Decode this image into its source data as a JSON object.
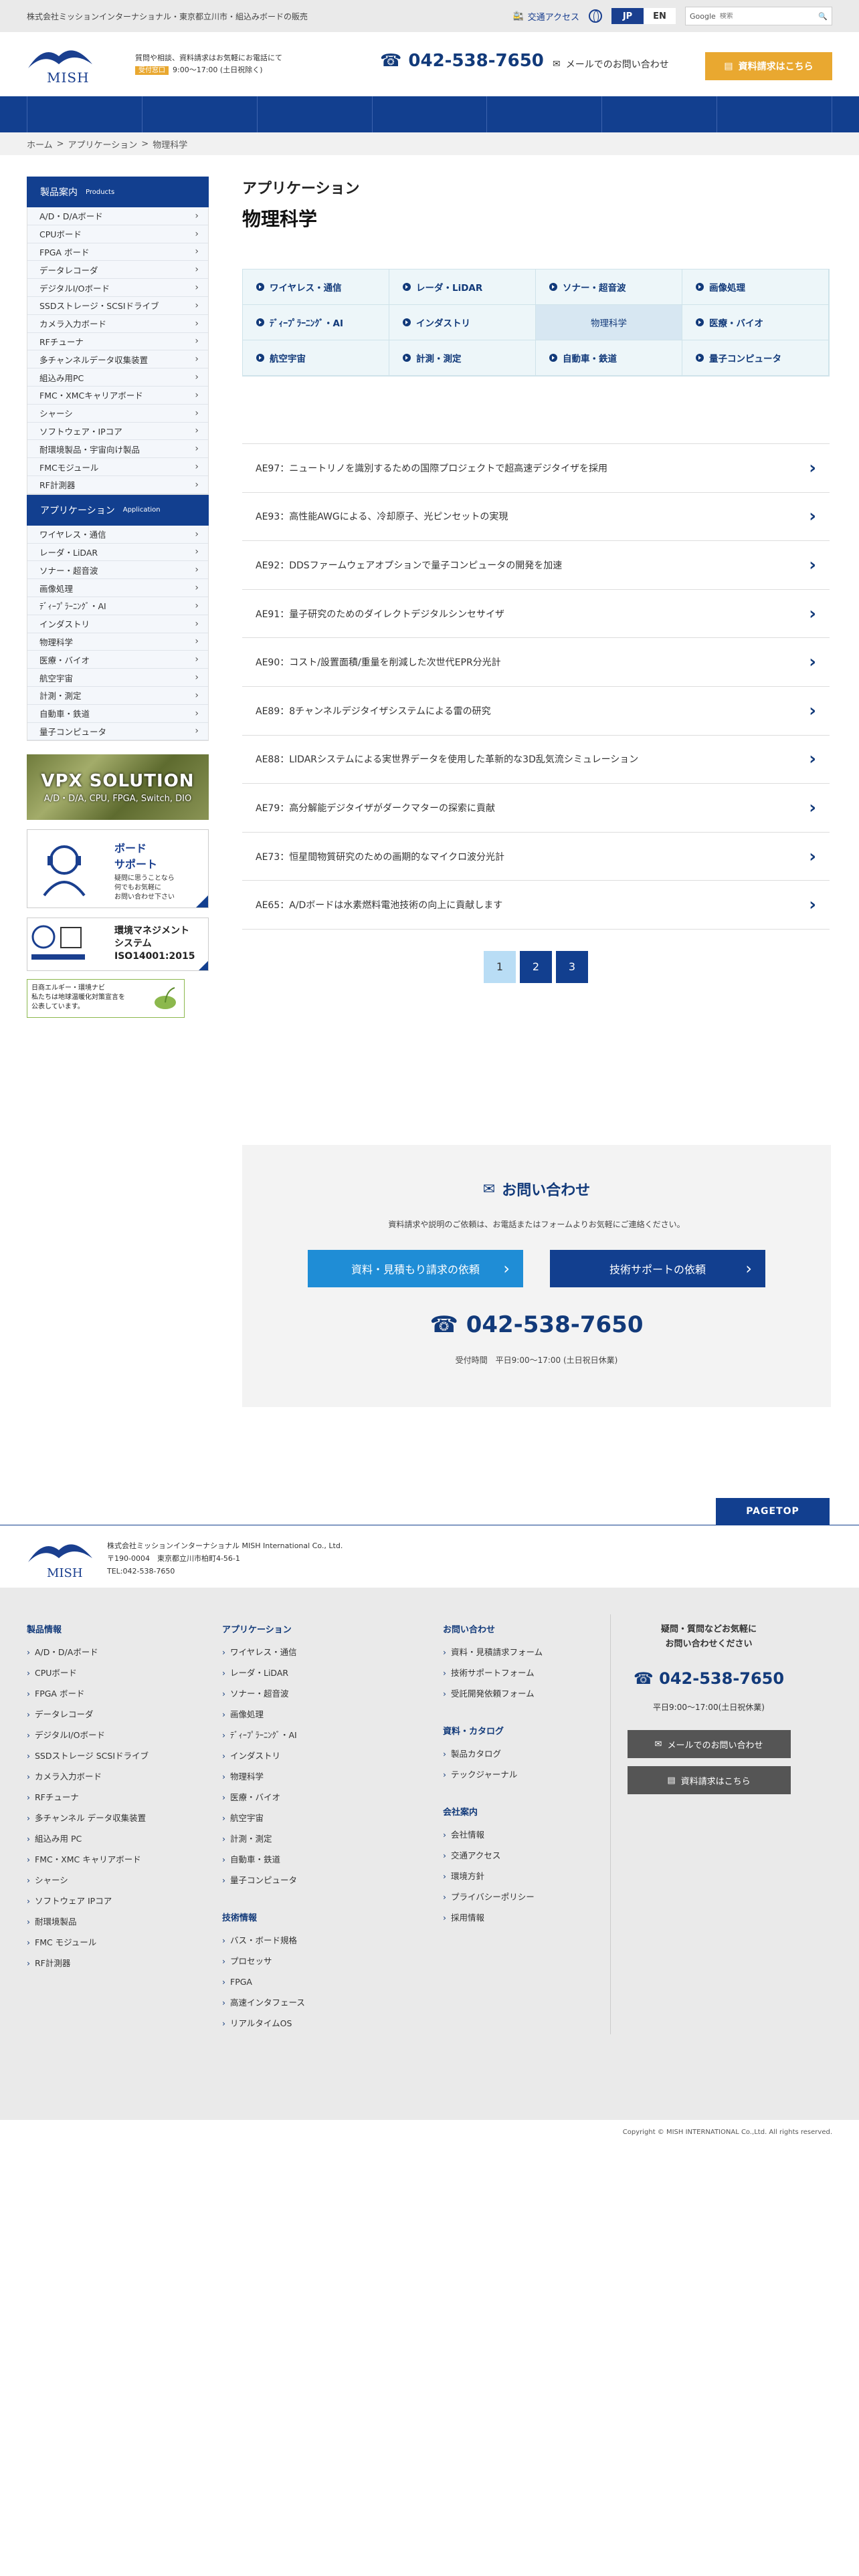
{
  "topbar": {
    "company_line": "株式会社ミッションインターナショナル・東京都立川市・組込みボードの販売",
    "access": "交通アクセス",
    "lang": [
      "JP",
      "EN"
    ],
    "search_label": "Google",
    "search_placeholder": "検索"
  },
  "header": {
    "logo_text": "MISH",
    "info_line": "質問や相談、資料請求はお気軽にお電話にて",
    "hours_badge": "受付窓口",
    "hours_text": "9:00〜17:00 (土日祝除く)",
    "phone": "042-538-7650",
    "mail_label": "メールでのお問い合わせ",
    "request_btn": "資料請求はこちら"
  },
  "breadcrumb": [
    "ホーム",
    ">",
    "アプリケーション",
    ">",
    "物理科学"
  ],
  "sidebar": {
    "products_head": "製品案内",
    "products_head_en": "Products",
    "products": [
      "A/D・D/Aボード",
      "CPUボード",
      "FPGA ボード",
      "データレコーダ",
      "デジタルI/Oボード",
      "SSDストレージ・SCSIドライブ",
      "カメラ入力ボード",
      "RFチューナ",
      "多チャンネルデータ収集装置",
      "組込み用PC",
      "FMC・XMCキャリアボード",
      "シャーシ",
      "ソフトウェア・IPコア",
      "耐環境製品・宇宙向け製品",
      "FMCモジュール",
      "RF計測器"
    ],
    "apps_head": "アプリケーション",
    "apps_head_en": "Application",
    "apps": [
      "ワイヤレス・通信",
      "レーダ・LiDAR",
      "ソナー・超音波",
      "画像処理",
      "ﾃﾞｨｰﾌﾟﾗｰﾆﾝｸﾞ・AI",
      "インダストリ",
      "物理科学",
      "医療・バイオ",
      "航空宇宙",
      "計測・測定",
      "自動車・鉄道",
      "量子コンピュータ"
    ],
    "banner_vpx_title": "VPX SOLUTION",
    "banner_vpx_sub": "A/D・D/A, CPU, FPGA, Switch, DIO",
    "banner_support_t1": "ボード",
    "banner_support_t2": "サポート",
    "banner_support_desc1": "疑問に思うことなら",
    "banner_support_desc2": "何でもお気軽に",
    "banner_support_desc3": "お問い合わせ下さい",
    "banner_iso_l1": "環境マネジメント",
    "banner_iso_l2": "システム",
    "banner_iso_l3": "ISO14001:2015",
    "banner_eco_l1": "日商エルギー・環境ナビ",
    "banner_eco_l2": "私たちは地球温暖化対策宣言を",
    "banner_eco_l3": "公表しています。"
  },
  "main": {
    "category": "アプリケーション",
    "title": "物理科学",
    "cats": [
      "ワイヤレス・通信",
      "レーダ・LiDAR",
      "ソナー・超音波",
      "画像処理",
      "ﾃﾞｨｰﾌﾟﾗｰﾆﾝｸﾞ・AI",
      "インダストリ",
      "物理科学",
      "医療・バイオ",
      "航空宇宙",
      "計測・測定",
      "自動車・鉄道",
      "量子コンピュータ"
    ],
    "articles": [
      "AE97：ニュートリノを識別するための国際プロジェクトで超高速デジタイザを採用",
      "AE93：高性能AWGによる、冷却原子、光ピンセットの実現",
      "AE92：DDSファームウェアオプションで量子コンピュータの開発を加速",
      "AE91：量子研究のためのダイレクトデジタルシンセサイザ",
      "AE90：コスト/設置面積/重量を削減した次世代EPR分光計",
      "AE89：8チャンネルデジタイザシステムによる雷の研究",
      "AE88：LIDARシステムによる実世界データを使用した革新的な3D乱気流シミュレーション",
      "AE79：高分解能デジタイザがダークマターの探索に貢献",
      "AE73：恒星間物質研究のための画期的なマイクロ波分光計",
      "AE65：A/Dボードは水素燃料電池技術の向上に貢献します"
    ],
    "pages": [
      "1",
      "2",
      "3"
    ]
  },
  "contact": {
    "title": "お問い合わせ",
    "desc": "資料請求や説明のご依頼は、お電話またはフォームよりお気軽にご連絡ください。",
    "btn_quote": "資料・見積もり請求の依頼",
    "btn_support": "技術サポートの依頼",
    "phone": "042-538-7650",
    "hours": "受付時間　平日9:00〜17:00 (土日祝日休業)"
  },
  "footer": {
    "pagetop": "PAGETOP",
    "company": "株式会社ミッションインターナショナル MISH International Co., Ltd.",
    "address": "〒190-0004　東京都立川市柏町4-56-1",
    "tel": "TEL:042-538-7650",
    "products_head": "製品情報",
    "products": [
      "A/D・D/Aボード",
      "CPUボード",
      "FPGA ボード",
      "データレコーダ",
      "デジタルI/Oボード",
      "SSDストレージ SCSIドライブ",
      "カメラ入力ボード",
      "RFチューナ",
      "多チャンネル データ収集装置",
      "組込み用 PC",
      "FMC・XMC キャリアボード",
      "シャーシ",
      "ソフトウェア IPコア",
      "耐環境製品",
      "FMC モジュール",
      "RF計測器"
    ],
    "apps_head": "アプリケーション",
    "apps": [
      "ワイヤレス・通信",
      "レーダ・LiDAR",
      "ソナー・超音波",
      "画像処理",
      "ﾃﾞｨｰﾌﾟﾗｰﾆﾝｸﾞ・AI",
      "インダストリ",
      "物理科学",
      "医療・バイオ",
      "航空宇宙",
      "計測・測定",
      "自動車・鉄道",
      "量子コンピュータ"
    ],
    "tech_head": "技術情報",
    "tech": [
      "バス・ボード規格",
      "プロセッサ",
      "FPGA",
      "高速インタフェース",
      "リアルタイムOS"
    ],
    "contact_head": "お問い合わせ",
    "contact": [
      "資料・見積請求フォーム",
      "技術サポートフォーム",
      "受託開発依頼フォーム"
    ],
    "catalog_head": "資料・カタログ",
    "catalog": [
      "製品カタログ",
      "テックジャーナル"
    ],
    "company_head": "会社案内",
    "company_links": [
      "会社情報",
      "交通アクセス",
      "環境方針",
      "プライバシーポリシー",
      "採用情報"
    ],
    "right_q1": "疑問・質問などお気軽に",
    "right_q2": "お問い合わせください",
    "right_phone": "042-538-7650",
    "right_hours": "平日9:00〜17:00(土日祝休業)",
    "right_mail": "メールでのお問い合わせ",
    "right_request": "資料請求はこちら",
    "copyright": "Copyright © MISH INTERNATIONAL Co.,Ltd. All rights reserved."
  }
}
